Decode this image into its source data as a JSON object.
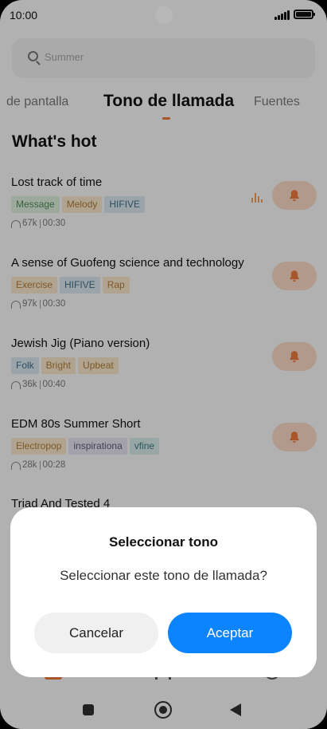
{
  "status_bar": {
    "time": "10:00"
  },
  "search": {
    "placeholder": "Summer"
  },
  "tabs": [
    {
      "label": "de pantalla"
    },
    {
      "label": "Tono de llamada"
    },
    {
      "label": "Fuentes"
    }
  ],
  "section": {
    "title": "What's hot"
  },
  "songs": [
    {
      "title": "Lost track of time",
      "tags": [
        "Message",
        "Melody",
        "HIFIVE"
      ],
      "plays": "67k",
      "duration": "00:30"
    },
    {
      "title": "A sense of Guofeng science and technology",
      "tags": [
        "Exercise",
        "HIFIVE",
        "Rap"
      ],
      "plays": "97k",
      "duration": "00:30"
    },
    {
      "title": "Jewish Jig (Piano version)",
      "tags": [
        "Folk",
        "Bright",
        "Upbeat"
      ],
      "plays": "36k",
      "duration": "00:40"
    },
    {
      "title": "EDM 80s Summer Short",
      "tags": [
        "Electropop",
        "inspirationa",
        "vfine"
      ],
      "plays": "28k",
      "duration": "00:28"
    },
    {
      "title": "Triad And Tested 4"
    }
  ],
  "dialog": {
    "title": "Seleccionar tono",
    "message": "Seleccionar este tono de llamada?",
    "cancel_label": "Cancelar",
    "accept_label": "Aceptar"
  },
  "colors": {
    "accent": "#e8763a",
    "primary_button": "#0d84ff"
  }
}
